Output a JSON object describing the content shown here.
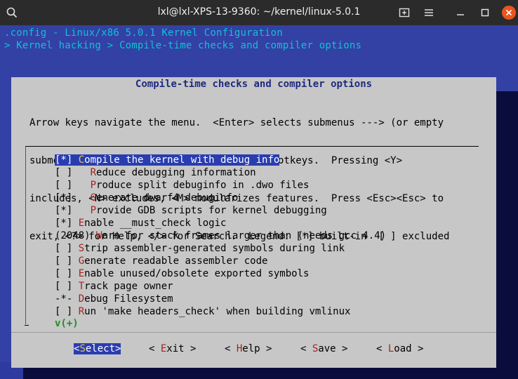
{
  "window": {
    "title": "lxl@lxl-XPS-13-9360: ~/kernel/linux-5.0.1",
    "search_icon": "search-icon",
    "icons": [
      "new-tab-icon",
      "menu-icon",
      "minimize-icon",
      "maximize-icon",
      "close-icon"
    ]
  },
  "terminal": {
    "line1": ".config - Linux/x86 5.0.1 Kernel Configuration",
    "line2": "> Kernel hacking > Compile-time checks and compiler options"
  },
  "dialog": {
    "title": "Compile-time checks and compiler options",
    "help": [
      "Arrow keys navigate the menu.  <Enter> selects submenus ---> (or empty",
      "submenus ----).  Highlighted letters are hotkeys.  Pressing <Y>",
      "includes, <N> excludes, <M> modularizes features.  Press <Esc><Esc> to",
      "exit, <?> for Help, </> for Search.  Legend: [*] built-in  [ ] excluded"
    ],
    "items": [
      {
        "prefix": "[*] ",
        "hot": "C",
        "rest": "ompile the kernel with debug info",
        "selected": true
      },
      {
        "prefix": "[ ]   ",
        "hot": "R",
        "rest": "educe debugging information"
      },
      {
        "prefix": "[ ]   ",
        "hot": "P",
        "rest": "roduce split debuginfo in .dwo files"
      },
      {
        "prefix": "[*]   ",
        "hot": "G",
        "rest": "enerate dwarf4 debuginfo"
      },
      {
        "prefix": "[*]   ",
        "hot": "P",
        "rest": "rovide GDB scripts for kernel debugging"
      },
      {
        "prefix": "[*] ",
        "hot": "E",
        "rest": "nable __must_check logic"
      },
      {
        "prefix": "(2048) ",
        "hot": "W",
        "rest": "arn for stack frames larger than (needs gcc 4.4)"
      },
      {
        "prefix": "[ ] ",
        "hot": "S",
        "rest": "trip assembler-generated symbols during link"
      },
      {
        "prefix": "[ ] ",
        "hot": "G",
        "rest": "enerate readable assembler code"
      },
      {
        "prefix": "[ ] ",
        "hot": "E",
        "rest": "nable unused/obsolete exported symbols"
      },
      {
        "prefix": "[ ] ",
        "hot": "T",
        "rest": "rack page owner"
      },
      {
        "prefix": "-*- ",
        "hot": "D",
        "rest": "ebug Filesystem"
      },
      {
        "prefix": "[ ] ",
        "hot": "R",
        "rest": "un 'make headers_check' when building vmlinux"
      }
    ],
    "more_indicator": "v(+)",
    "buttons": [
      {
        "open": "<",
        "hot": "S",
        "rest": "elect",
        "close": ">",
        "active": true
      },
      {
        "open": "< ",
        "hot": "E",
        "rest": "xit",
        "close": " >"
      },
      {
        "open": "< ",
        "hot": "H",
        "rest": "elp",
        "close": " >"
      },
      {
        "open": "< ",
        "hot": "S",
        "rest": "ave",
        "close": " >"
      },
      {
        "open": "< ",
        "hot": "L",
        "rest": "oad",
        "close": " >"
      }
    ]
  }
}
